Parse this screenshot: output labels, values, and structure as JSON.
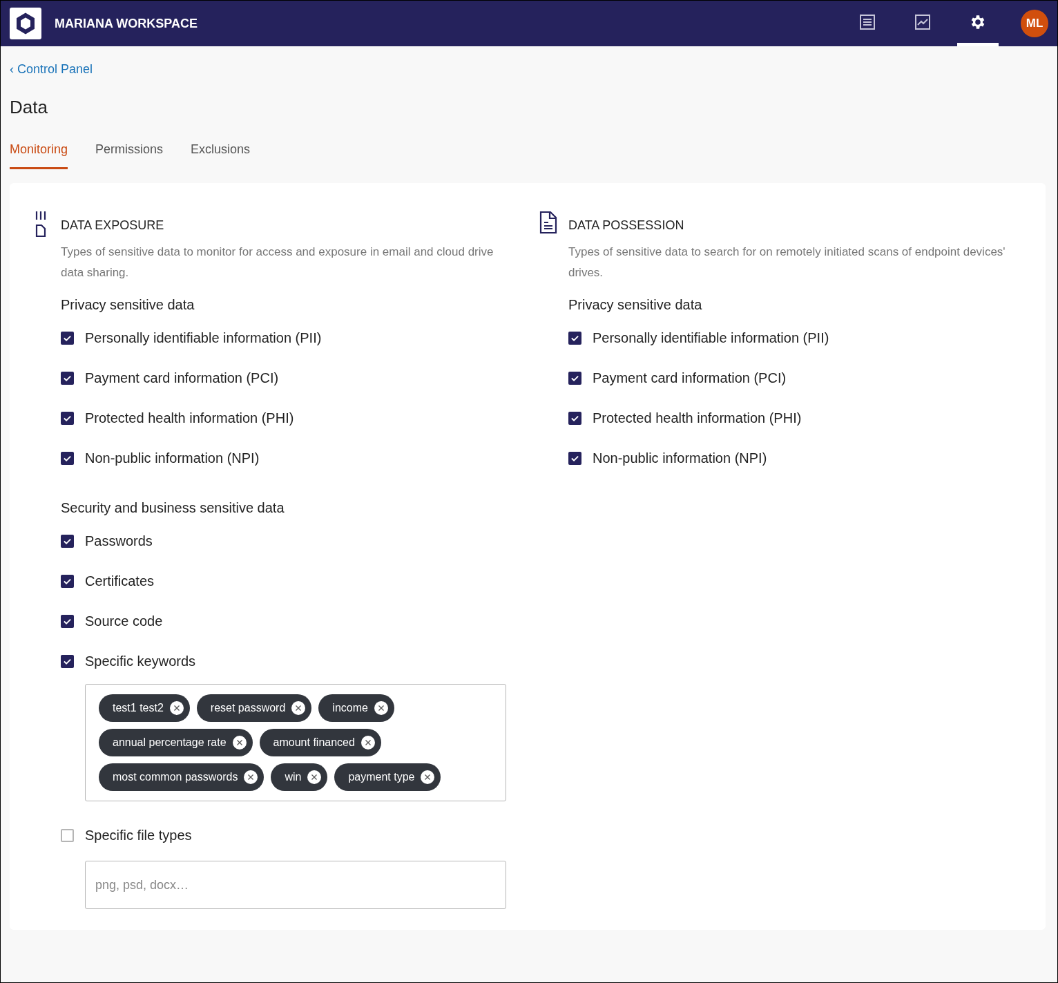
{
  "header": {
    "brand": "MARIANA WORKSPACE",
    "nav_icons": [
      {
        "kind": "list",
        "selected": false
      },
      {
        "kind": "chart",
        "selected": false
      },
      {
        "kind": "settings",
        "selected": true
      }
    ],
    "avatar": "ML"
  },
  "breadcrumb": "‹ Control Panel",
  "title": "Data",
  "tabs": [
    {
      "label": "Monitoring",
      "selected": true
    },
    {
      "label": "Permissions",
      "selected": false
    },
    {
      "label": "Exclusions",
      "selected": false
    }
  ],
  "sections": [
    {
      "kind": "exposure",
      "title": "DATA EXPOSURE",
      "description": "Types of sensitive data to monitor for access and exposure in email and cloud drive data sharing.",
      "groups": [
        {
          "heading": "Privacy sensitive data",
          "options": [
            {
              "kind": "plain",
              "label": "Personally identifiable information (PII)",
              "checked": true
            },
            {
              "kind": "plain",
              "label": "Payment card information (PCI)",
              "checked": true
            },
            {
              "kind": "plain",
              "label": "Protected health information (PHI)",
              "checked": true
            },
            {
              "kind": "plain",
              "label": "Non-public information (NPI)",
              "checked": true
            }
          ]
        },
        {
          "heading": "Security and business sensitive data",
          "options": [
            {
              "kind": "plain",
              "label": "Passwords",
              "checked": true
            },
            {
              "kind": "plain",
              "label": "Certificates",
              "checked": true
            },
            {
              "kind": "plain",
              "label": "Source code",
              "checked": true
            },
            {
              "kind": "keywords",
              "label": "Specific keywords",
              "checked": true,
              "tags": [
                "test1 test2",
                "reset password",
                "income",
                "annual percentage rate",
                "amount financed",
                "most common passwords",
                "win",
                "payment type"
              ]
            },
            {
              "kind": "filetypes",
              "label": "Specific file types",
              "checked": false,
              "placeholder": "png, psd, docx…"
            }
          ]
        }
      ]
    },
    {
      "kind": "possession",
      "title": "DATA POSSESSION",
      "description": "Types of sensitive data to search for on remotely initiated scans of endpoint devices' drives.",
      "groups": [
        {
          "heading": "Privacy sensitive data",
          "options": [
            {
              "kind": "plain",
              "label": "Personally identifiable information (PII)",
              "checked": true
            },
            {
              "kind": "plain",
              "label": "Payment card information (PCI)",
              "checked": true
            },
            {
              "kind": "plain",
              "label": "Protected health information (PHI)",
              "checked": true
            },
            {
              "kind": "plain",
              "label": "Non-public information (NPI)",
              "checked": true
            }
          ]
        }
      ]
    }
  ]
}
